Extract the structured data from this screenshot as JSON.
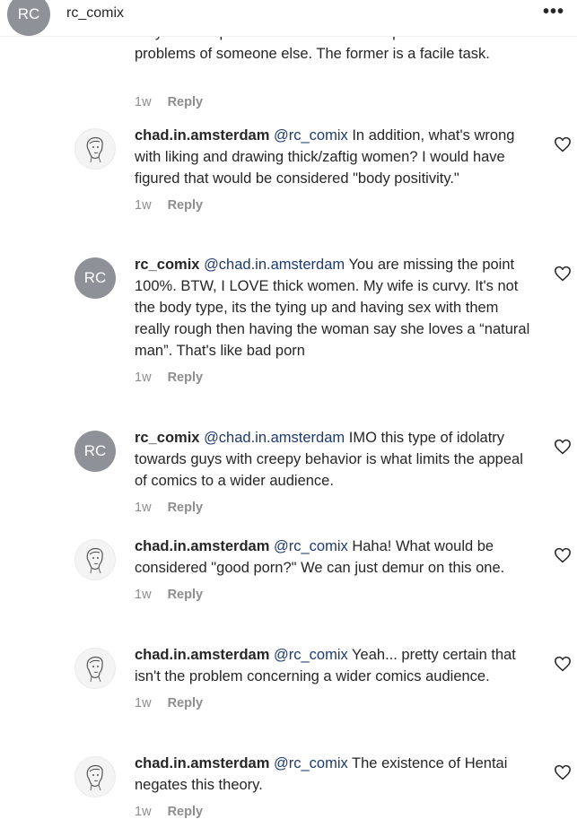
{
  "header": {
    "avatar_initials": "RC",
    "username": "rc_comix",
    "more_label": "•••"
  },
  "previous_comment": {
    "text_partial": "on your own problems than it takes to speak on the",
    "text_line2": "problems of someone else. The former is a facile task.",
    "time": "1w",
    "reply": "Reply"
  },
  "comments": [
    {
      "avatar": "sketch",
      "username": "chad.in.amsterdam",
      "mention": "@rc_comix",
      "text": "In addition, what's wrong with liking and drawing thick/zaftig women? I would have figured that would be considered \"body positivity.\"",
      "time": "1w",
      "reply": "Reply"
    },
    {
      "avatar": "RC",
      "username": "rc_comix",
      "mention": "@chad.in.amsterdam",
      "text": "You are missing the point 100%. BTW, I LOVE thick women. My wife is curvy. It's not the body type, its the tying up and having sex with them really rough then having the woman say she loves a “natural man”. That's like bad porn",
      "time": "1w",
      "reply": "Reply"
    },
    {
      "avatar": "RC",
      "username": "rc_comix",
      "mention": "@chad.in.amsterdam",
      "text": "IMO this type of idolatry towards guys with creepy behavior is what limits the appeal of comics to a wider audience.",
      "time": "1w",
      "reply": "Reply"
    },
    {
      "avatar": "sketch",
      "username": "chad.in.amsterdam",
      "mention": "@rc_comix",
      "text": "Haha! What would be considered \"good porn?\" We can just demur on this one.",
      "time": "1w",
      "reply": "Reply"
    },
    {
      "avatar": "sketch",
      "username": "chad.in.amsterdam",
      "mention": "@rc_comix",
      "text": "Yeah... pretty certain that isn't the problem concerning a wider comics audience.",
      "time": "1w",
      "reply": "Reply"
    },
    {
      "avatar": "sketch",
      "username": "chad.in.amsterdam",
      "mention": "@rc_comix",
      "text": "The existence of Hentai negates this theory.",
      "time": "1w",
      "reply": "Reply"
    }
  ]
}
